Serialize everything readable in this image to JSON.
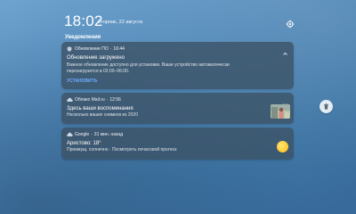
{
  "status": {
    "time": "18:02",
    "date": "Вторник, 22 августа"
  },
  "notifications_label": "Уведомления",
  "notifications": [
    {
      "app": "Обновление ПО",
      "time": "16:44",
      "icon": "system-update-icon",
      "title": "Обновление загружено",
      "body": "Важное обновление доступно для установки. Ваше устройство автоматически перезагрузится в 02:00–06:00.",
      "action": "УСТАНОВИТЬ"
    },
    {
      "app": "Облако Mail.ru",
      "time": "12:56",
      "icon": "cloud-icon",
      "title": "Здесь ваши воспоминания",
      "body": "Несколько ваших снимков из 2020"
    },
    {
      "app": "Google",
      "time": "31 мин. назад",
      "icon": "weather-cloud-icon",
      "title": "Аристово: 18°",
      "body": "Преимущ. солнечно · Посмотреть почасовой прогноз"
    }
  ],
  "colors": {
    "accent": "#6ab0ff",
    "card_bg": "#3c5366",
    "sun": "#ffcb2e"
  }
}
